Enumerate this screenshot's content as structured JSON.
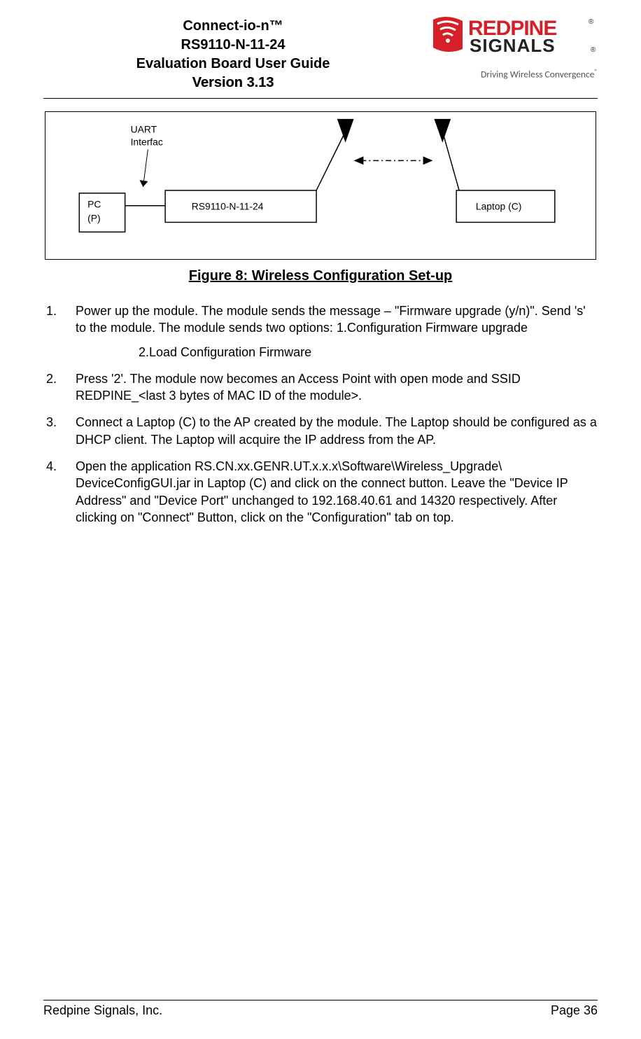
{
  "header": {
    "t1": "Connect-io-n™",
    "t2": "RS9110-N-11-24",
    "t3": "Evaluation Board User Guide",
    "t4": "Version 3.13"
  },
  "logo": {
    "name": "REDPINE",
    "sub": "SIGNALS",
    "tagline": "Driving Wireless Convergence"
  },
  "diagram": {
    "uart_label_l1": "UART",
    "uart_label_l2": "Interfac",
    "pc_l1": "PC",
    "pc_l2": "(P)",
    "module": "RS9110-N-11-24",
    "laptop": "Laptop (C)"
  },
  "caption": "Figure 8: Wireless Configuration Set-up",
  "steps": {
    "s1": "Power up the module. The module sends the message – \"Firmware upgrade (y/n)\". Send 's' to the module. The module sends two options: 1.Configuration Firmware upgrade",
    "s1b": "2.Load Configuration Firmware",
    "s2": "Press '2'. The module now becomes an Access Point with open mode and SSID REDPINE_<last 3 bytes of MAC ID of the module>.",
    "s3": "Connect a Laptop (C) to the AP created by the module. The Laptop should be configured as a DHCP client. The Laptop will acquire the IP address from the AP.",
    "s4": "Open the application RS.CN.xx.GENR.UT.x.x.x\\Software\\Wireless_Upgrade\\ DeviceConfigGUI.jar in Laptop (C) and click on the connect button. Leave the \"Device IP Address\" and \"Device Port\" unchanged to 192.168.40.61 and 14320 respectively. After clicking on \"Connect\" Button, click on the \"Configuration\" tab on top."
  },
  "footer": {
    "company": "Redpine Signals, Inc.",
    "page": "Page 36"
  }
}
